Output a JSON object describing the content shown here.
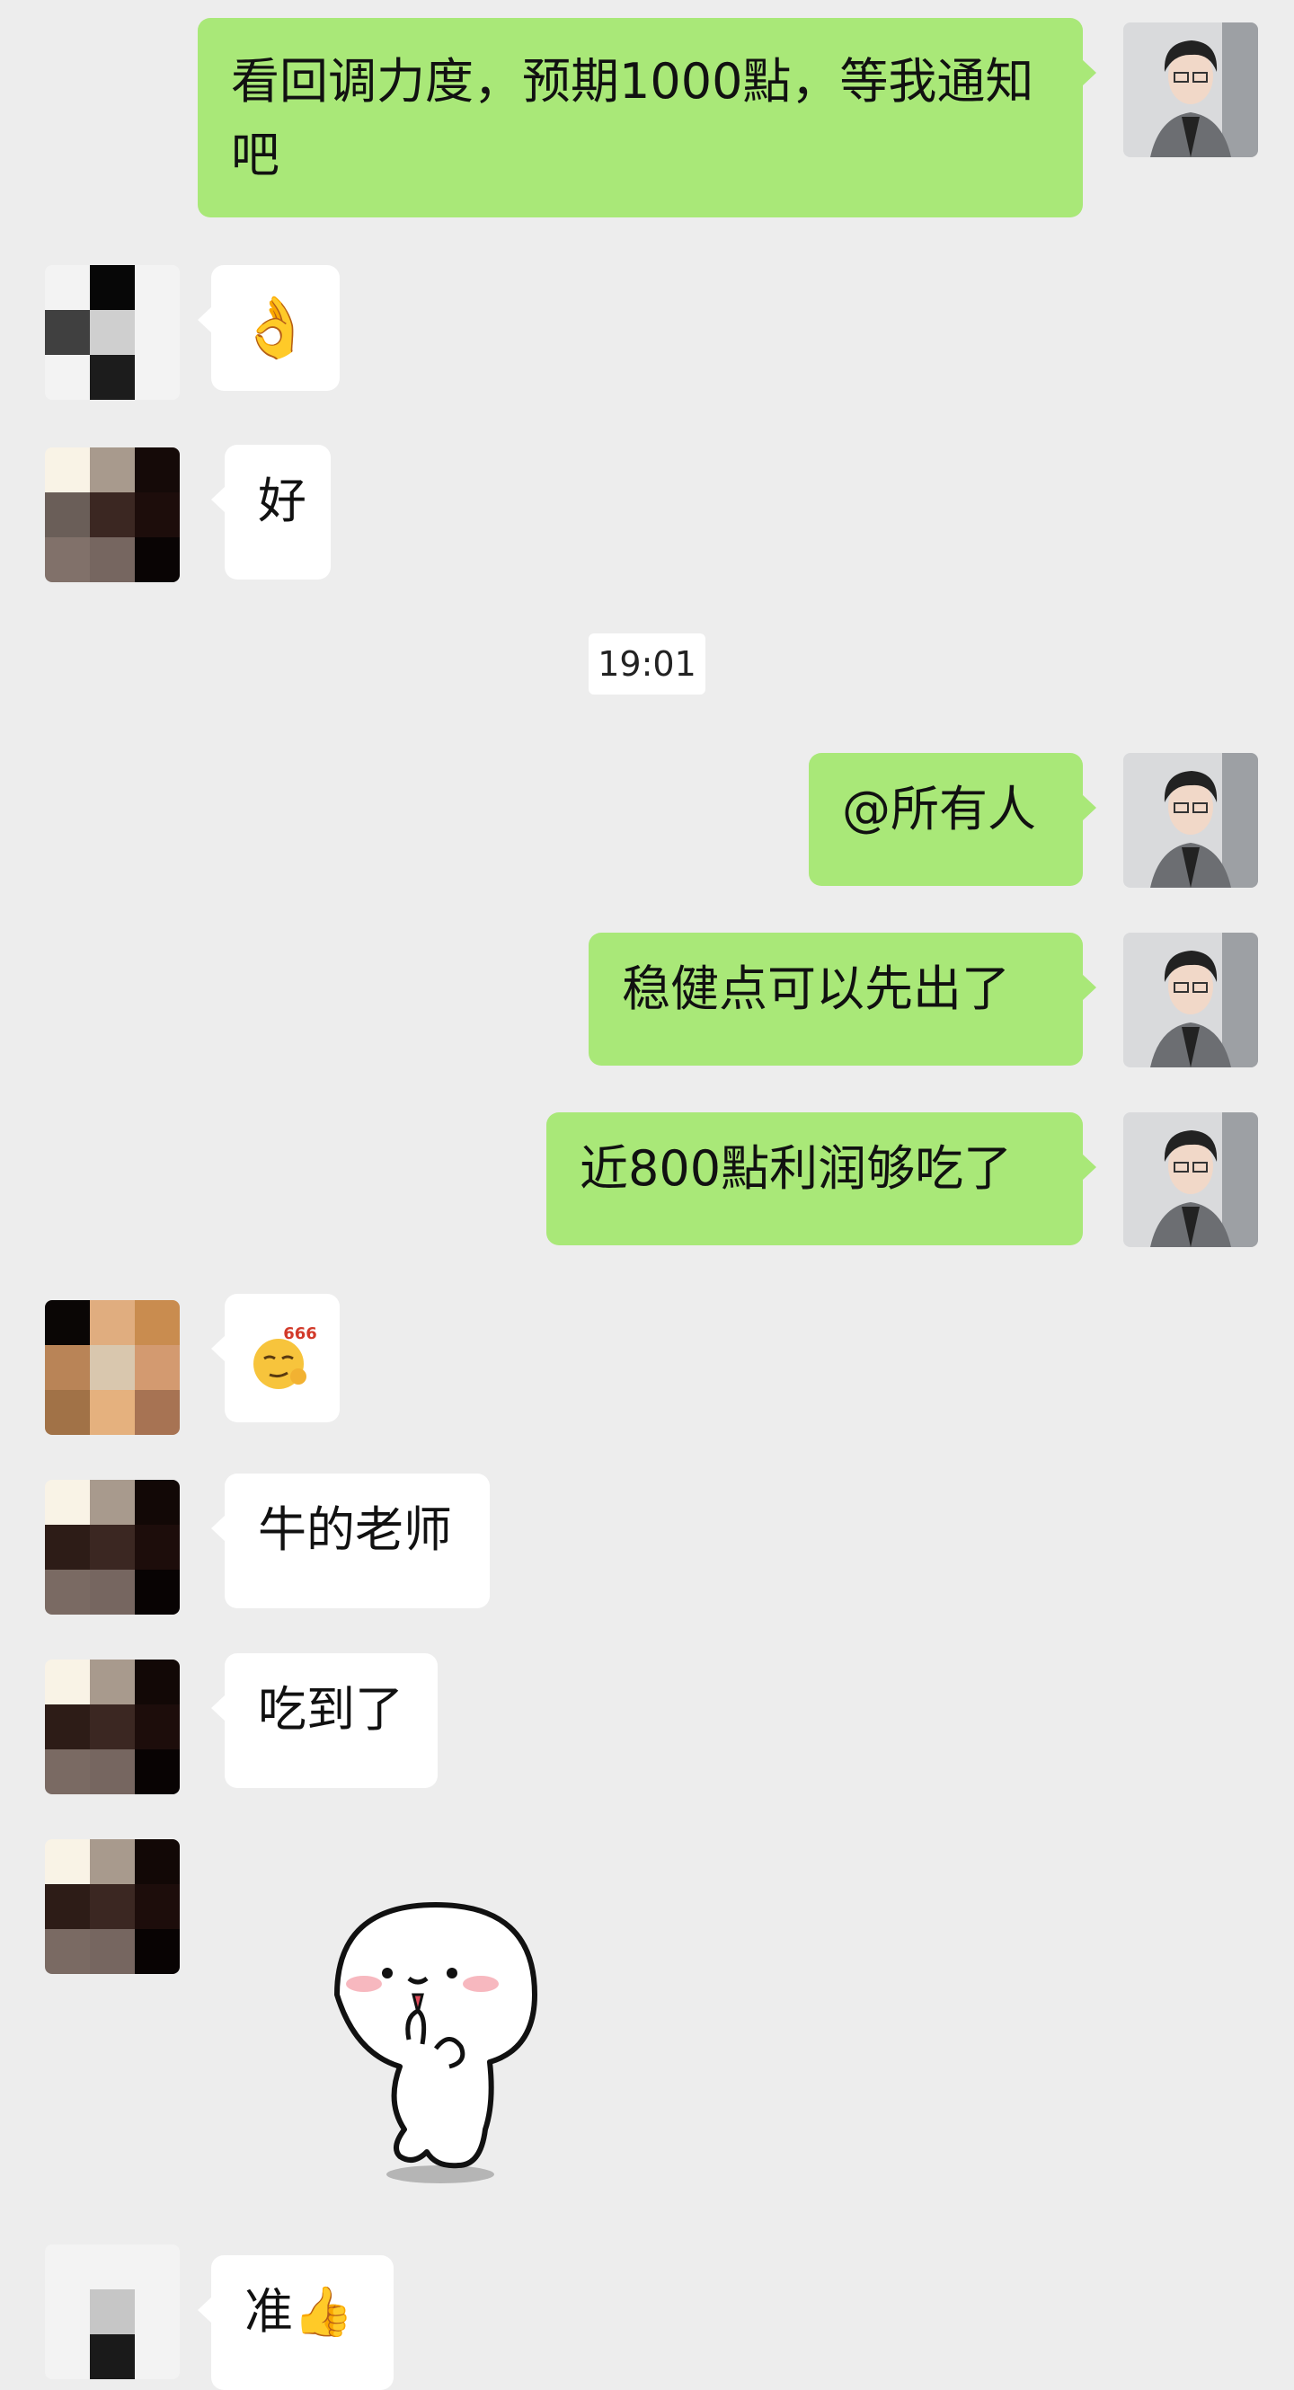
{
  "messages": [
    {
      "side": "out",
      "text": "看回调力度，预期1000點，等我通知吧"
    },
    {
      "side": "in",
      "emoji": "👌"
    },
    {
      "side": "in",
      "text": "好"
    },
    {
      "side": "out",
      "text": "@所有人"
    },
    {
      "side": "out",
      "text": "稳健点可以先出了"
    },
    {
      "side": "out",
      "text": "近800點利润够吃了"
    },
    {
      "side": "in",
      "emoji": "666",
      "emoji_name": "smirk-666-emoji"
    },
    {
      "side": "in",
      "text": "牛的老师"
    },
    {
      "side": "in",
      "text": "吃到了"
    },
    {
      "side": "in",
      "sticker": "dancing-bun-sticker"
    },
    {
      "side": "in",
      "text": "准",
      "emoji": "👍"
    }
  ],
  "timestamp": "19:01",
  "colors": {
    "out_bubble": "#a9e878",
    "in_bubble": "#ffffff",
    "background": "#ededed"
  }
}
